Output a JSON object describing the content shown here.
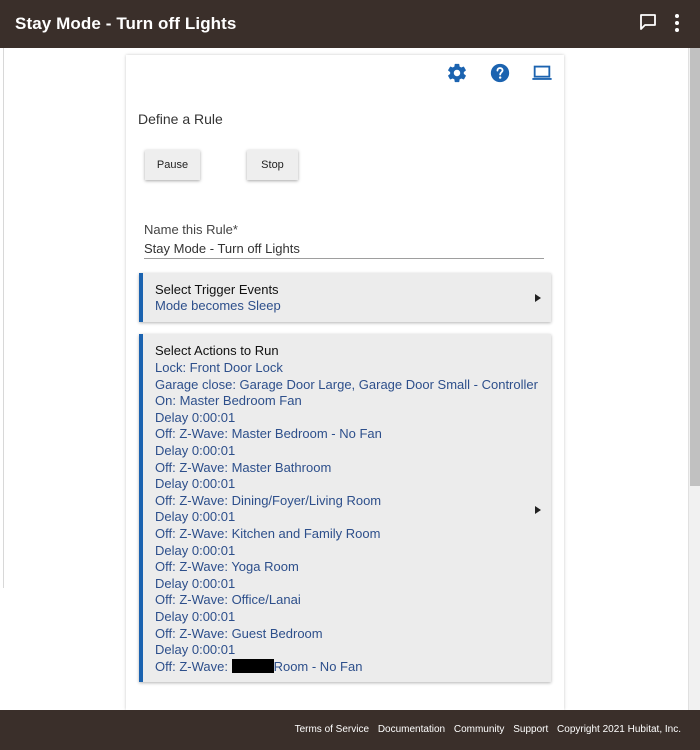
{
  "header": {
    "title": "Stay Mode - Turn off Lights",
    "chat_icon": "chat-icon",
    "menu_icon": "more-vertical-icon"
  },
  "toolbar": {
    "icons": [
      "gear-icon",
      "help-icon",
      "laptop-icon"
    ],
    "accent": "#1b63b0"
  },
  "section_title": "Define a Rule",
  "buttons": {
    "pause": "Pause",
    "stop": "Stop"
  },
  "name_field": {
    "label": "Name this Rule*",
    "value": "Stay Mode - Turn off Lights"
  },
  "trigger": {
    "title": "Select Trigger Events",
    "summary": "Mode becomes Sleep"
  },
  "actions": {
    "title": "Select Actions to Run",
    "lines": [
      "Lock: Front Door Lock",
      "Garage close: Garage Door Large, Garage Door Small - Controller",
      "On: Master Bedroom Fan",
      "Delay 0:00:01",
      "Off: Z-Wave: Master Bedroom - No Fan",
      "Delay 0:00:01",
      "Off: Z-Wave: Master Bathroom",
      "Delay 0:00:01",
      "Off: Z-Wave: Dining/Foyer/Living Room",
      "Delay 0:00:01",
      "Off: Z-Wave: Kitchen and Family Room",
      "Delay 0:00:01",
      "Off: Z-Wave: Yoga Room",
      "Delay 0:00:01",
      "Off: Z-Wave: Office/Lanai",
      "Delay 0:00:01",
      "Off: Z-Wave: Guest Bedroom",
      "Delay 0:00:01"
    ],
    "last_line_prefix": "Off: Z-Wave: ",
    "last_line_suffix": "Room - No Fan"
  },
  "footer": {
    "links": [
      "Terms of Service",
      "Documentation",
      "Community",
      "Support"
    ],
    "copyright": "Copyright 2021 Hubitat, Inc."
  },
  "colors": {
    "header_bg": "#3a2f2a",
    "link_text": "#2d4f8b",
    "panel_bg": "#ececec"
  }
}
